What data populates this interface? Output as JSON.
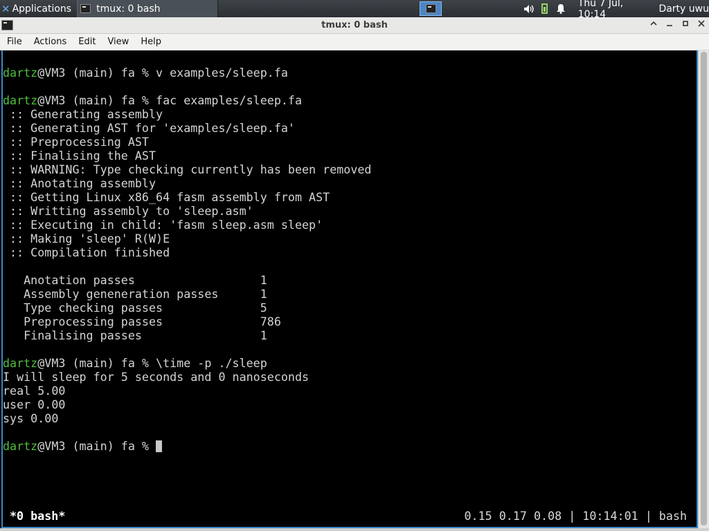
{
  "panel": {
    "applications_label": "Applications",
    "task_label": "tmux: 0 bash",
    "clock": "Thu  7 Jul, 10:14",
    "user": "Darty uwu",
    "icons": [
      "xfce-logo-icon",
      "terminal-icon",
      "volume-icon",
      "battery-icon",
      "notification-bell-icon"
    ]
  },
  "window": {
    "title": "tmux: 0 bash",
    "controls": [
      "maximize-up-icon",
      "minimize-icon",
      "restore-icon",
      "close-icon"
    ],
    "accent": "#3b87c7"
  },
  "menubar": {
    "items": [
      "File",
      "Actions",
      "Edit",
      "View",
      "Help"
    ]
  },
  "terminal": {
    "prompt_user": "dartz",
    "prompt_rest": "@VM3 (main) fa % ",
    "lines": [
      {
        "kind": "prompt",
        "cmd": "v examples/sleep.fa"
      },
      {
        "kind": "blank",
        "text": ""
      },
      {
        "kind": "prompt",
        "cmd": "fac examples/sleep.fa"
      },
      {
        "kind": "out",
        "text": " :: Generating assembly"
      },
      {
        "kind": "out",
        "text": " :: Generating AST for 'examples/sleep.fa'"
      },
      {
        "kind": "out",
        "text": " :: Preprocessing AST"
      },
      {
        "kind": "out",
        "text": " :: Finalising the AST"
      },
      {
        "kind": "out",
        "text": " :: WARNING: Type checking currently has been removed"
      },
      {
        "kind": "out",
        "text": " :: Anotating assembly"
      },
      {
        "kind": "out",
        "text": " :: Getting Linux x86_64 fasm assembly from AST"
      },
      {
        "kind": "out",
        "text": " :: Writting assembly to 'sleep.asm'"
      },
      {
        "kind": "out",
        "text": " :: Executing in child: 'fasm sleep.asm sleep'"
      },
      {
        "kind": "out",
        "text": " :: Making 'sleep' R(W)E"
      },
      {
        "kind": "out",
        "text": " :: Compilation finished"
      },
      {
        "kind": "blank",
        "text": ""
      },
      {
        "kind": "out",
        "text": "   Anotation passes                  1"
      },
      {
        "kind": "out",
        "text": "   Assembly geneneration passes      1"
      },
      {
        "kind": "out",
        "text": "   Type checking passes              5"
      },
      {
        "kind": "out",
        "text": "   Preprocessing passes              786"
      },
      {
        "kind": "out",
        "text": "   Finalising passes                 1"
      },
      {
        "kind": "blank",
        "text": ""
      },
      {
        "kind": "prompt",
        "cmd": "\\time -p ./sleep"
      },
      {
        "kind": "out",
        "text": "I will sleep for 5 seconds and 0 nanoseconds"
      },
      {
        "kind": "out",
        "text": "real 5.00"
      },
      {
        "kind": "out",
        "text": "user 0.00"
      },
      {
        "kind": "out",
        "text": "sys 0.00"
      },
      {
        "kind": "blank",
        "text": ""
      },
      {
        "kind": "prompt_active",
        "cmd": ""
      }
    ],
    "status_left": "*0 bash*",
    "status_right": "0.15 0.17 0.08 | 10:14:01 | bash",
    "colors": {
      "user": "#4fbf3c",
      "text": "#d4d4d4",
      "background": "#000000"
    }
  }
}
